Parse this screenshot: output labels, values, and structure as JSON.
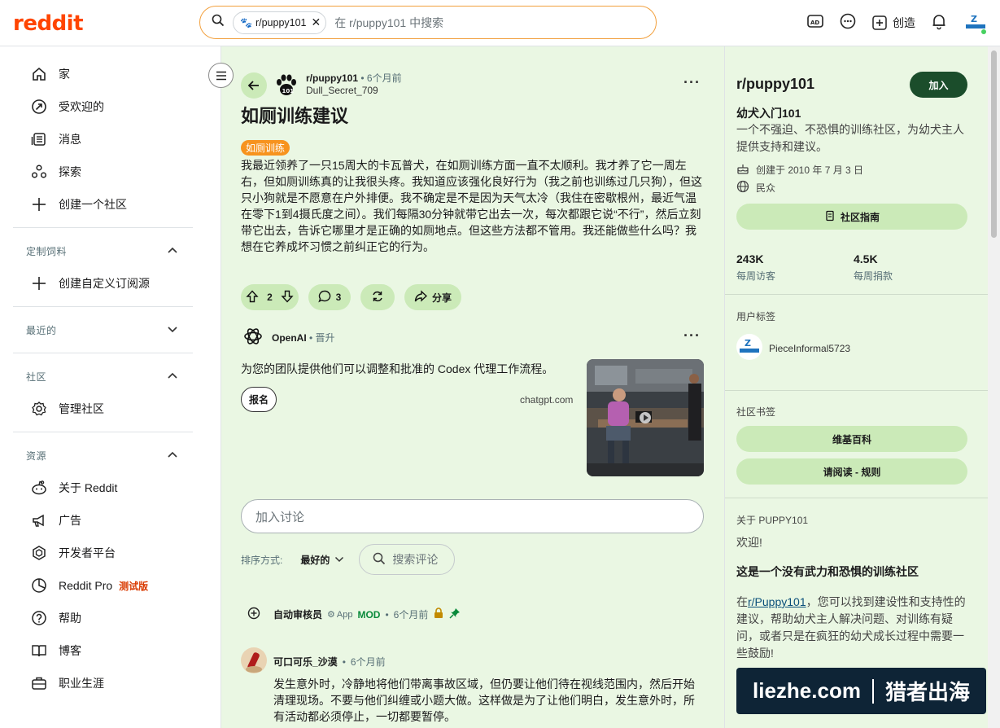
{
  "header": {
    "logo": "reddit",
    "search_chip": "r/puppy101",
    "search_placeholder": "在 r/puppy101 中搜索",
    "create_label": "创造"
  },
  "sidebar": {
    "items": [
      {
        "label": "家",
        "icon": "home-icon"
      },
      {
        "label": "受欢迎的",
        "icon": "popular-icon"
      },
      {
        "label": "消息",
        "icon": "news-icon"
      },
      {
        "label": "探索",
        "icon": "explore-icon"
      },
      {
        "label": "创建一个社区",
        "icon": "plus-icon"
      }
    ],
    "section_feeds": "定制饲料",
    "create_feed": "创建自定义订阅源",
    "section_recent": "最近的",
    "section_communities": "社区",
    "manage_communities": "管理社区",
    "section_resources": "资源",
    "resources": [
      {
        "label": "关于 Reddit",
        "icon": "reddit-alien-icon"
      },
      {
        "label": "广告",
        "icon": "megaphone-icon"
      },
      {
        "label": "开发者平台",
        "icon": "dev-platform-icon"
      },
      {
        "label": "Reddit Pro",
        "icon": "pro-icon",
        "badge": "测试版"
      },
      {
        "label": "帮助",
        "icon": "help-icon"
      },
      {
        "label": "博客",
        "icon": "blog-icon"
      },
      {
        "label": "职业生涯",
        "icon": "briefcase-icon"
      }
    ]
  },
  "post": {
    "subreddit": "r/puppy101",
    "time": "6个月前",
    "author": "Dull_Secret_709",
    "title": "如厕训练建议",
    "flair": "如厕训练",
    "body": "我最近领养了一只15周大的卡瓦普犬，在如厕训练方面一直不太顺利。我才养了它一周左右，但如厕训练真的让我很头疼。我知道应该强化良好行为（我之前也训练过几只狗），但这只小狗就是不愿意在户外排便。我不确定是不是因为天气太冷（我住在密歇根州，最近气温在零下1到4摄氏度之间）。我们每隔30分钟就带它出去一次，每次都跟它说“不行”，然后立刻带它出去，告诉它哪里才是正确的如厕地点。但这些方法都不管用。我还能做些什么吗？我想在它养成坏习惯之前纠正它的行为。",
    "votes": "2",
    "comments": "3",
    "share": "分享"
  },
  "ad": {
    "brand": "OpenAI",
    "tag": "晋升",
    "text": "为您的团队提供他们可以调整和批准的 Codex 代理工作流程。",
    "button": "报名",
    "domain": "chatgpt.com"
  },
  "discussion": {
    "placeholder": "加入讨论",
    "sort_label": "排序方式:",
    "sort_value": "最好的",
    "search_comments": "搜索评论"
  },
  "comments": [
    {
      "author": "自动审核员",
      "app": "App",
      "mod": "MOD",
      "time": "6个月前"
    },
    {
      "author": "可口可乐_沙漠",
      "time": "6个月前",
      "body": "发生意外时，冷静地将他们带离事故区域，但仍要让他们待在视线范围内，然后开始清理现场。不要与他们纠缠或小题大做。这样做是为了让他们明白，发生意外时，所有活动都必须停止，一切都要暂停。"
    }
  ],
  "community": {
    "name": "r/puppy101",
    "join": "加入",
    "subtitle": "幼犬入门101",
    "description": "一个不强迫、不恐惧的训练社区，为幼犬主人提供支持和建议。",
    "created": "创建于 2010 年 7 月 3 日",
    "visibility": "民众",
    "guide_button": "社区指南",
    "weekly_visitors": "243K",
    "weekly_visitors_label": "每周访客",
    "weekly_contrib": "4.5K",
    "weekly_contrib_label": "每周捐款",
    "user_flair_head": "用户标签",
    "user_flair_name": "PieceInformal5723",
    "bookmarks_head": "社区书签",
    "bookmark_1": "维基百科",
    "bookmark_2": "请阅读 - 规则",
    "about_head": "关于 PUPPY101",
    "welcome": "欢迎!",
    "tagline": "这是一个没有武力和恐惧的训练社区",
    "about_prefix": "在",
    "about_link": "r/Puppy101",
    "about_text": "，您可以找到建设性和支持性的建议，帮助幼犬主人解决问题、对训练有疑问，或者只是在疯狂的幼犬成长过程中需要一些鼓励!"
  },
  "watermark": {
    "domain": "liezhe.com",
    "name": "猎者出海"
  },
  "colors": {
    "brand": "#ff4500",
    "accent_bg": "#eaf7e3",
    "pill": "#cbeab8",
    "join": "#1b4d2b",
    "flair": "#f7931e"
  }
}
